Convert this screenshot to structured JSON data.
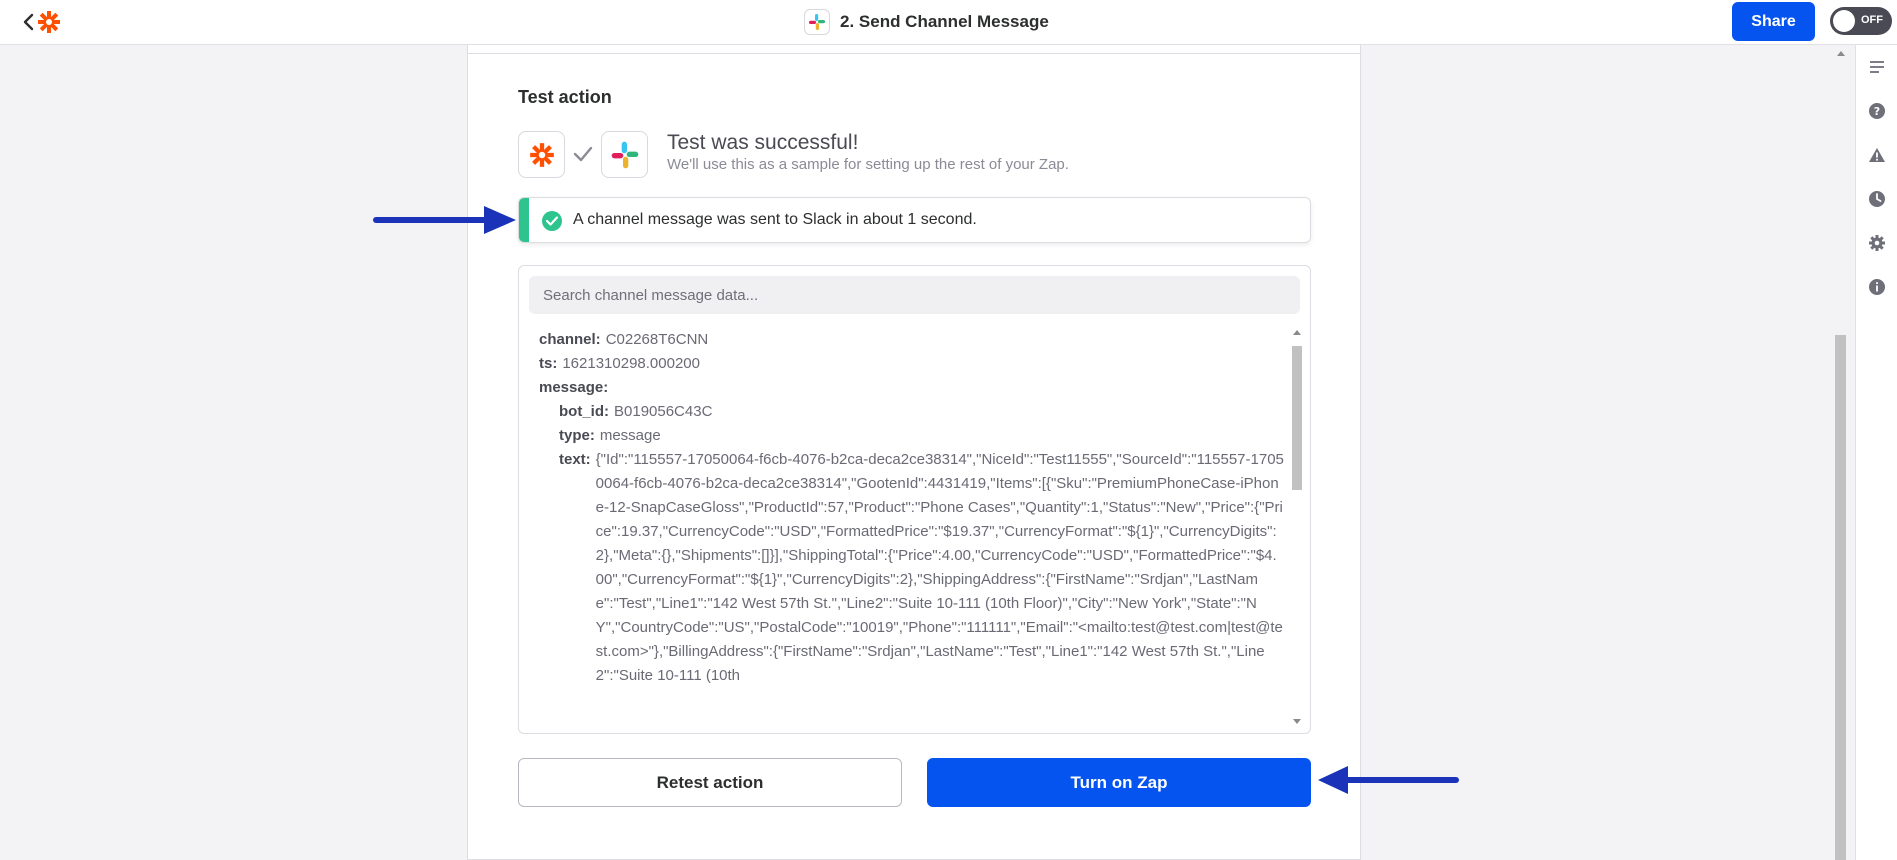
{
  "header": {
    "title": "2. Send Channel Message",
    "share_label": "Share",
    "toggle_label": "OFF"
  },
  "test_action": {
    "heading": "Test action",
    "success_title": "Test was successful!",
    "success_subtitle": "We'll use this as a sample for setting up the rest of your Zap.",
    "banner_text": "A channel message was sent to Slack in about 1 second.",
    "search_placeholder": "Search channel message data...",
    "fields": [
      {
        "key": "channel:",
        "value": "C02268T6CNN",
        "indent": false
      },
      {
        "key": "ts:",
        "value": "1621310298.000200",
        "indent": false
      },
      {
        "key": "message:",
        "value": "",
        "indent": false
      },
      {
        "key": "bot_id:",
        "value": "B019056C43C",
        "indent": true
      },
      {
        "key": "type:",
        "value": "message",
        "indent": true
      },
      {
        "key": "text:",
        "value": "{\"Id\":\"115557-17050064-f6cb-4076-b2ca-deca2ce38314\",\"NiceId\":\"Test11555\",\"SourceId\":\"115557-17050064-f6cb-4076-b2ca-deca2ce38314\",\"GootenId\":4431419,\"Items\":[{\"Sku\":\"PremiumPhoneCase-iPhone-12-SnapCaseGloss\",\"ProductId\":57,\"Product\":\"Phone Cases\",\"Quantity\":1,\"Status\":\"New\",\"Price\":{\"Price\":19.37,\"CurrencyCode\":\"USD\",\"FormattedPrice\":\"$19.37\",\"CurrencyFormat\":\"${1}\",\"CurrencyDigits\":2},\"Meta\":{},\"Shipments\":[]}],\"ShippingTotal\":{\"Price\":4.00,\"CurrencyCode\":\"USD\",\"FormattedPrice\":\"$4.00\",\"CurrencyFormat\":\"${1}\",\"CurrencyDigits\":2},\"ShippingAddress\":{\"FirstName\":\"Srdjan\",\"LastName\":\"Test\",\"Line1\":\"142 West 57th St.\",\"Line2\":\"Suite 10-111 (10th Floor)\",\"City\":\"New York\",\"State\":\"NY\",\"CountryCode\":\"US\",\"PostalCode\":\"10019\",\"Phone\":\"111111\",\"Email\":\"<mailto:test@test.com|test@test.com>\"},\"BillingAddress\":{\"FirstName\":\"Srdjan\",\"LastName\":\"Test\",\"Line1\":\"142 West 57th St.\",\"Line2\":\"Suite 10-111 (10th",
        "indent": true
      }
    ],
    "retest_label": "Retest action",
    "turn_on_label": "Turn on Zap"
  },
  "icons": {
    "back": "chevron-left-icon",
    "logo": "zapier-logo-icon",
    "slack": "slack-icon",
    "rail": [
      "outline-icon",
      "help-icon",
      "warning-icon",
      "history-icon",
      "settings-icon",
      "info-icon"
    ]
  },
  "colors": {
    "primary": "#0554ef",
    "zapier_orange": "#ff4f00",
    "success": "#2dc48d",
    "annotation": "#1a33b8"
  }
}
